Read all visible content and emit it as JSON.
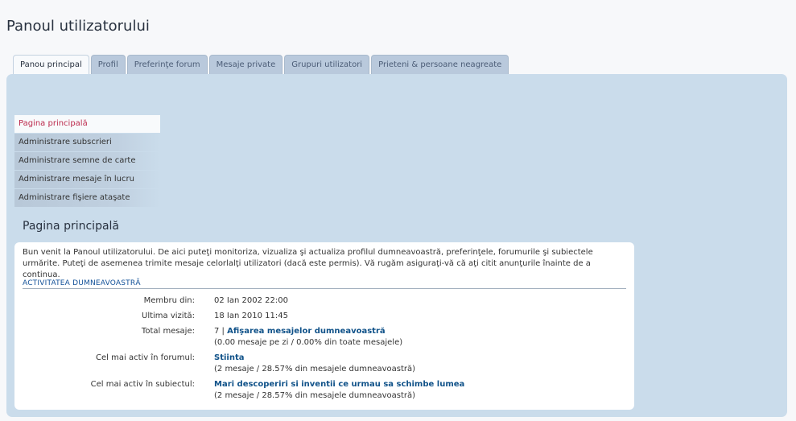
{
  "page": {
    "title": "Panoul utilizatorului"
  },
  "tabs": [
    {
      "label": "Panou principal",
      "active": true
    },
    {
      "label": "Profil"
    },
    {
      "label": "Preferinţe forum"
    },
    {
      "label": "Mesaje private"
    },
    {
      "label": "Grupuri utilizatori"
    },
    {
      "label": "Prieteni & persoane neagreate"
    }
  ],
  "menu": [
    {
      "label": "Pagina principală",
      "active": true
    },
    {
      "label": "Administrare subscrieri"
    },
    {
      "label": "Administrare semne de carte"
    },
    {
      "label": "Administrare mesaje în lucru"
    },
    {
      "label": "Administrare fişiere ataşate"
    }
  ],
  "main": {
    "heading": "Pagina principală",
    "intro": "Bun venit la Panoul utilizatorului. De aici puteţi monitoriza, vizualiza şi actualiza profilul dumneavoastră, preferinţele, forumurile şi subiectele urmărite. Puteţi de asemenea trimite mesaje celorlalţi utilizatori (dacă este permis). Vă rugăm asiguraţi-vă că aţi citit anunţurile înainte de a continua.",
    "activity_heading": "Activitatea dumneavoastră",
    "member_since_label": "Membru din:",
    "member_since": "02 Ian 2002 22:00",
    "last_visit_label": "Ultima vizită:",
    "last_visit": "18 Ian 2010 11:45",
    "total_posts_label": "Total mesaje:",
    "total_posts_count": "7 |",
    "total_posts_link": "Afişarea mesajelor dumneavoastră",
    "total_posts_stats": "(0.00 mesaje pe zi / 0.00% din toate mesajele)",
    "active_forum_label": "Cel mai activ în forumul:",
    "active_forum": "Stiinta",
    "active_forum_stats": "(2 mesaje / 28.57% din mesajele dumneavoastră)",
    "active_topic_label": "Cel mai activ în subiectul:",
    "active_topic": "Mari descoperiri si inventii ce urmau sa schimbe lumea",
    "active_topic_stats": "(2 mesaje / 28.57% din mesajele dumneavoastră)"
  }
}
